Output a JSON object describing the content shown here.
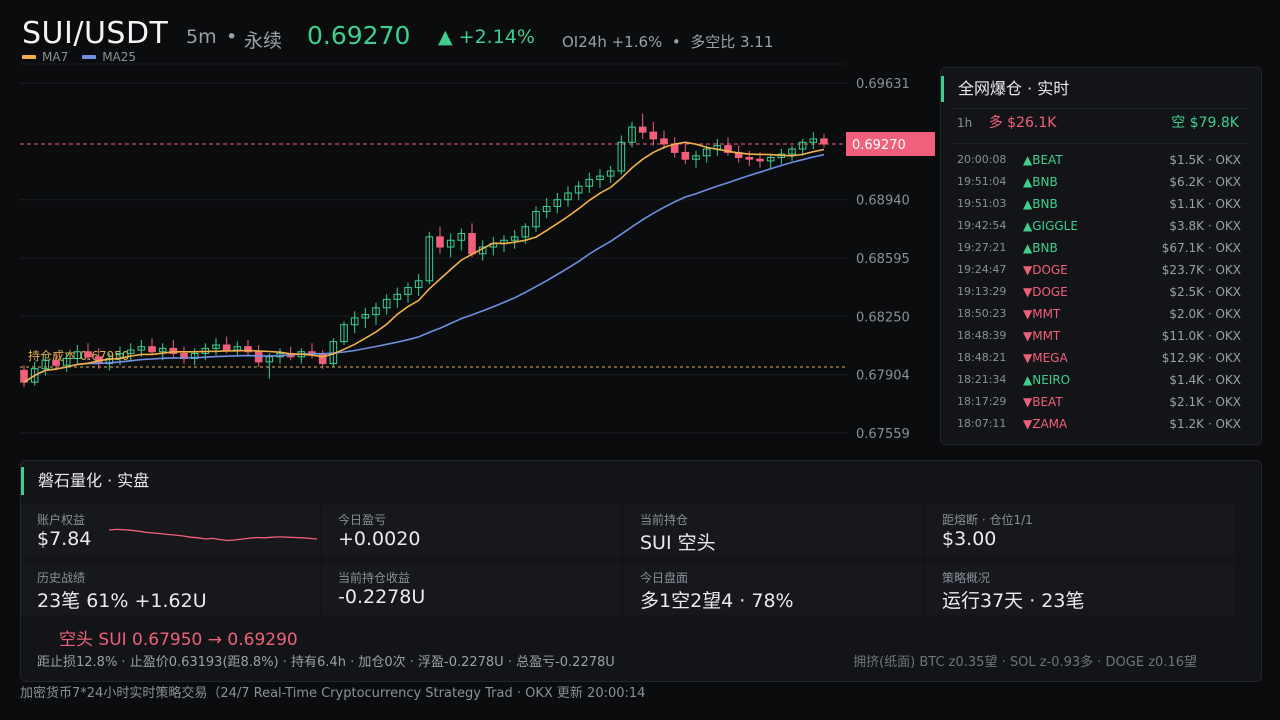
{
  "header": {
    "pair": "SUI/USDT",
    "timeframe": "5m",
    "separator": "•",
    "contract": "永续",
    "price": "0.69270",
    "change": "▲ +2.14%",
    "oi": "OI24h +1.6%",
    "ls_ratio": "多空比 3.11"
  },
  "legend": [
    {
      "label": "MA7",
      "color": "#f0b04a"
    },
    {
      "label": "MA25",
      "color": "#6f8fe0"
    }
  ],
  "chart_data": {
    "type": "candlestick",
    "y_ticks": [
      "0.69631",
      "0.68940",
      "0.68595",
      "0.68250",
      "0.67904",
      "0.67559"
    ],
    "ylim": [
      0.67559,
      0.69631
    ],
    "last_price_label": "0.69270",
    "cost_line": {
      "label": "持仓成本 0.67950",
      "value": 0.6795
    },
    "ma_colors": {
      "ma7": "#f0b04a",
      "ma25": "#6f8fe0"
    },
    "up_color": "#3ecf8e",
    "down_color": "#f0607a",
    "candles": [
      [
        0.6793,
        0.6796,
        0.6783,
        0.6786
      ],
      [
        0.6786,
        0.6798,
        0.6784,
        0.6794
      ],
      [
        0.6794,
        0.6802,
        0.679,
        0.6799
      ],
      [
        0.6799,
        0.6804,
        0.6793,
        0.6796
      ],
      [
        0.6796,
        0.6803,
        0.6792,
        0.68
      ],
      [
        0.68,
        0.6808,
        0.6797,
        0.6804
      ],
      [
        0.6804,
        0.6809,
        0.6799,
        0.6801
      ],
      [
        0.6801,
        0.6806,
        0.6794,
        0.6797
      ],
      [
        0.6797,
        0.6803,
        0.6793,
        0.68
      ],
      [
        0.68,
        0.6807,
        0.6796,
        0.6803
      ],
      [
        0.6803,
        0.6809,
        0.6799,
        0.6805
      ],
      [
        0.6805,
        0.6811,
        0.6801,
        0.6807
      ],
      [
        0.6807,
        0.6812,
        0.6802,
        0.6804
      ],
      [
        0.6804,
        0.6809,
        0.6799,
        0.6806
      ],
      [
        0.6806,
        0.6811,
        0.6801,
        0.6803
      ],
      [
        0.6803,
        0.6807,
        0.6797,
        0.68
      ],
      [
        0.68,
        0.6806,
        0.6796,
        0.6803
      ],
      [
        0.6803,
        0.6809,
        0.6799,
        0.6806
      ],
      [
        0.6806,
        0.6812,
        0.6802,
        0.6808
      ],
      [
        0.6808,
        0.6813,
        0.6803,
        0.6805
      ],
      [
        0.6805,
        0.681,
        0.6801,
        0.6807
      ],
      [
        0.6807,
        0.6811,
        0.6802,
        0.6804
      ],
      [
        0.6804,
        0.6808,
        0.6795,
        0.6798
      ],
      [
        0.6798,
        0.6803,
        0.6788,
        0.6801
      ],
      [
        0.6801,
        0.6806,
        0.6797,
        0.6803
      ],
      [
        0.6803,
        0.6807,
        0.6799,
        0.6801
      ],
      [
        0.6801,
        0.6806,
        0.6797,
        0.6804
      ],
      [
        0.6804,
        0.6809,
        0.68,
        0.6803
      ],
      [
        0.6803,
        0.6805,
        0.6794,
        0.6797
      ],
      [
        0.6797,
        0.6812,
        0.6795,
        0.681
      ],
      [
        0.681,
        0.6822,
        0.6808,
        0.682
      ],
      [
        0.682,
        0.6828,
        0.6815,
        0.6824
      ],
      [
        0.6824,
        0.683,
        0.6818,
        0.6826
      ],
      [
        0.6826,
        0.6833,
        0.682,
        0.683
      ],
      [
        0.683,
        0.6838,
        0.6826,
        0.6835
      ],
      [
        0.6835,
        0.6842,
        0.683,
        0.6838
      ],
      [
        0.6838,
        0.6845,
        0.6833,
        0.6842
      ],
      [
        0.6842,
        0.685,
        0.6837,
        0.6846
      ],
      [
        0.6846,
        0.6875,
        0.6844,
        0.6872
      ],
      [
        0.6872,
        0.6878,
        0.6862,
        0.6866
      ],
      [
        0.6866,
        0.6874,
        0.686,
        0.687
      ],
      [
        0.687,
        0.6877,
        0.6864,
        0.6874
      ],
      [
        0.6874,
        0.688,
        0.686,
        0.6862
      ],
      [
        0.6862,
        0.687,
        0.6858,
        0.6866
      ],
      [
        0.6866,
        0.6872,
        0.6861,
        0.6868
      ],
      [
        0.6868,
        0.6873,
        0.6863,
        0.687
      ],
      [
        0.687,
        0.6876,
        0.6865,
        0.6872
      ],
      [
        0.6872,
        0.688,
        0.6868,
        0.6878
      ],
      [
        0.6878,
        0.689,
        0.6875,
        0.6887
      ],
      [
        0.6887,
        0.6895,
        0.6883,
        0.689
      ],
      [
        0.689,
        0.6898,
        0.6886,
        0.6894
      ],
      [
        0.6894,
        0.6902,
        0.689,
        0.6898
      ],
      [
        0.6898,
        0.6905,
        0.6894,
        0.6902
      ],
      [
        0.6902,
        0.691,
        0.6898,
        0.6906
      ],
      [
        0.6906,
        0.6912,
        0.6901,
        0.6908
      ],
      [
        0.6908,
        0.6914,
        0.6904,
        0.6911
      ],
      [
        0.6911,
        0.6932,
        0.6909,
        0.6928
      ],
      [
        0.6928,
        0.694,
        0.6925,
        0.6937
      ],
      [
        0.6937,
        0.6945,
        0.693,
        0.6934
      ],
      [
        0.6934,
        0.694,
        0.6926,
        0.693
      ],
      [
        0.693,
        0.6935,
        0.6924,
        0.6927
      ],
      [
        0.6927,
        0.6931,
        0.6919,
        0.6922
      ],
      [
        0.6922,
        0.6927,
        0.6915,
        0.6918
      ],
      [
        0.6918,
        0.6923,
        0.6913,
        0.692
      ],
      [
        0.692,
        0.6926,
        0.6916,
        0.6924
      ],
      [
        0.6924,
        0.693,
        0.692,
        0.6926
      ],
      [
        0.6926,
        0.6931,
        0.692,
        0.6922
      ],
      [
        0.6922,
        0.6926,
        0.6916,
        0.6919
      ],
      [
        0.6919,
        0.6923,
        0.6914,
        0.6918
      ],
      [
        0.6918,
        0.6922,
        0.6913,
        0.6917
      ],
      [
        0.6917,
        0.6921,
        0.6912,
        0.6919
      ],
      [
        0.6919,
        0.6924,
        0.6915,
        0.6921
      ],
      [
        0.6921,
        0.6926,
        0.6917,
        0.6924
      ],
      [
        0.6924,
        0.693,
        0.692,
        0.6928
      ],
      [
        0.6928,
        0.6934,
        0.6924,
        0.693
      ],
      [
        0.693,
        0.6933,
        0.6925,
        0.6927
      ]
    ]
  },
  "liquidations": {
    "title": "全网爆仓 · 实时",
    "period": "1h",
    "long_total": "多 $26.1K",
    "short_total": "空 $79.8K",
    "rows": [
      {
        "time": "20:00:08",
        "side": "up",
        "label": "▲BEAT",
        "amount": "$1.5K · OKX"
      },
      {
        "time": "19:51:04",
        "side": "up",
        "label": "▲BNB",
        "amount": "$6.2K · OKX"
      },
      {
        "time": "19:51:03",
        "side": "up",
        "label": "▲BNB",
        "amount": "$1.1K · OKX"
      },
      {
        "time": "19:42:54",
        "side": "up",
        "label": "▲GIGGLE",
        "amount": "$3.8K · OKX"
      },
      {
        "time": "19:27:21",
        "side": "up",
        "label": "▲BNB",
        "amount": "$67.1K · OKX"
      },
      {
        "time": "19:24:47",
        "side": "down",
        "label": "▼DOGE",
        "amount": "$23.7K · OKX"
      },
      {
        "time": "19:13:29",
        "side": "down",
        "label": "▼DOGE",
        "amount": "$2.5K · OKX"
      },
      {
        "time": "18:50:23",
        "side": "down",
        "label": "▼MMT",
        "amount": "$2.0K · OKX"
      },
      {
        "time": "18:48:39",
        "side": "down",
        "label": "▼MMT",
        "amount": "$11.0K · OKX"
      },
      {
        "time": "18:48:21",
        "side": "down",
        "label": "▼MEGA",
        "amount": "$12.9K · OKX"
      },
      {
        "time": "18:21:34",
        "side": "up",
        "label": "▲NEIRO",
        "amount": "$1.4K · OKX"
      },
      {
        "time": "18:17:29",
        "side": "down",
        "label": "▼BEAT",
        "amount": "$2.1K · OKX"
      },
      {
        "time": "18:07:11",
        "side": "down",
        "label": "▼ZAMA",
        "amount": "$1.2K · OKX"
      }
    ]
  },
  "strategy": {
    "title": "磐石量化 · 实盘",
    "cards": [
      {
        "label": "账户权益",
        "value": "$7.84",
        "tone": "white"
      },
      {
        "label": "今日盈亏",
        "value": "+0.0020",
        "tone": "green"
      },
      {
        "label": "当前持仓",
        "value": "SUI 空头",
        "tone": "white"
      },
      {
        "label": "距熔断 · 仓位1/1",
        "value": "$3.00",
        "tone": "green"
      },
      {
        "label": "历史战绩",
        "value": "23笔 61% +1.62U",
        "tone": "green"
      },
      {
        "label": "当前持仓收益",
        "value": "-0.2278U",
        "tone": "red"
      },
      {
        "label": "今日盘面",
        "value": "多1空2望4 · 78%",
        "tone": "white"
      },
      {
        "label": "策略概况",
        "value": "运行37天 · 23笔",
        "tone": "white"
      }
    ],
    "equity_spark": [
      0.7,
      0.72,
      0.71,
      0.69,
      0.66,
      0.62,
      0.6,
      0.58,
      0.55,
      0.53,
      0.5,
      0.46,
      0.44,
      0.4,
      0.42,
      0.38,
      0.35,
      0.37,
      0.4,
      0.43,
      0.45,
      0.44,
      0.46,
      0.47,
      0.46,
      0.45,
      0.44,
      0.42,
      0.4
    ],
    "position_line": "空头 SUI   0.67950 → 0.69290",
    "position_detail": "距止损12.8% · 止盈价0.63193(距8.8%) · 持有6.4h · 加仓0次 · 浮盈-0.2278U · 总盈亏-0.2278U",
    "crowding": "拥挤(纸面) BTC z0.35望 · SOL z-0.93多 · DOGE z0.16望"
  },
  "footer": "加密货币7*24小时实时策略交易（24/7 Real-Time Cryptocurrency Strategy Trad · OKX 更新 20:00:14"
}
